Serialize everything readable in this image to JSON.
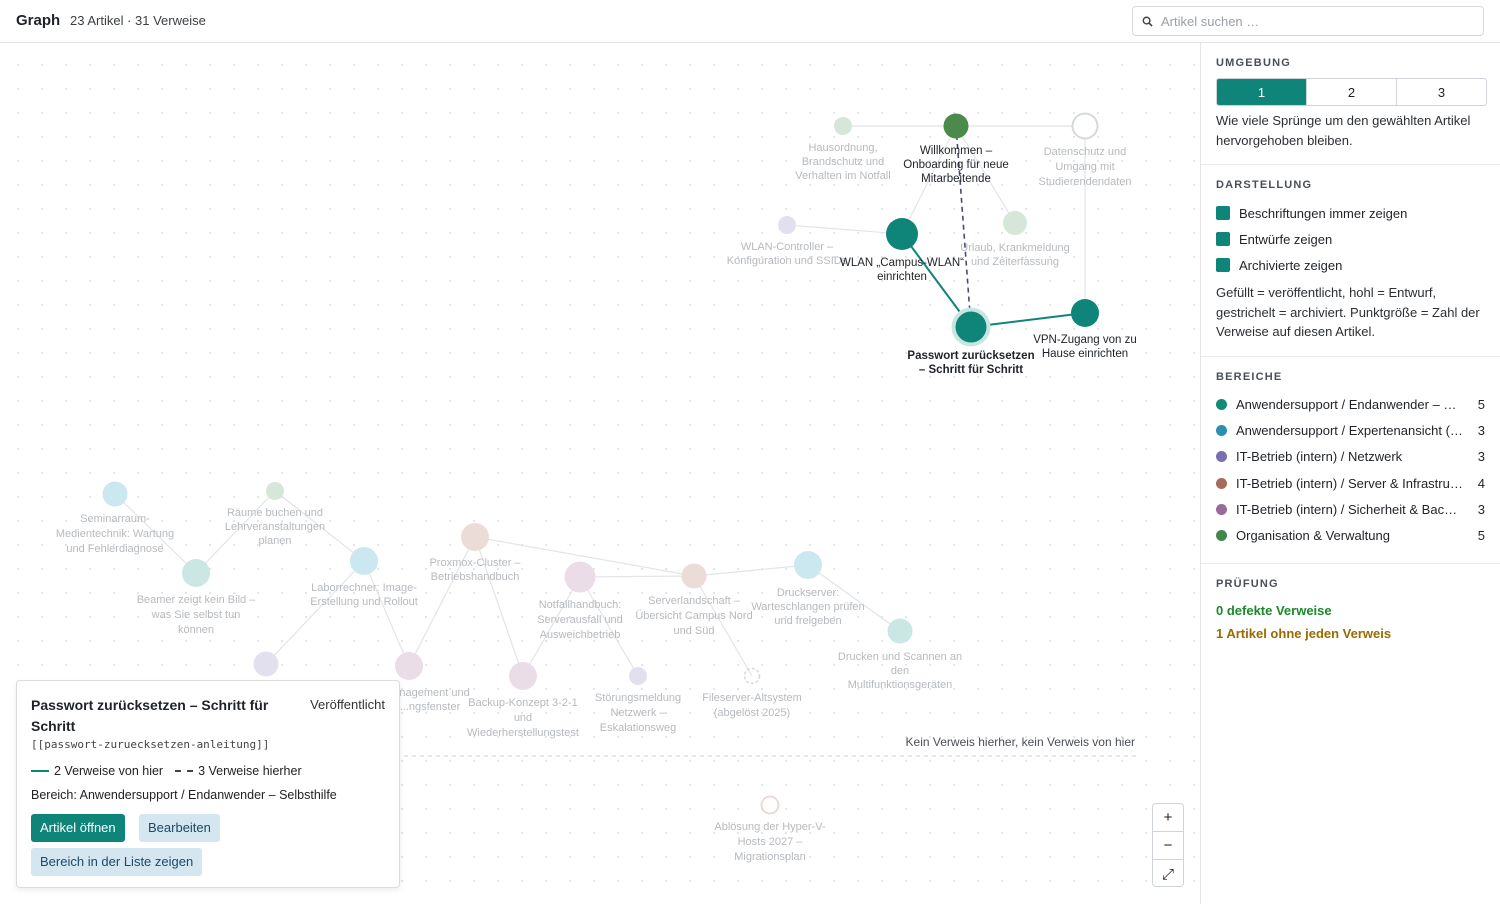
{
  "header": {
    "title": "Graph",
    "counts": "23 Artikel · 31 Verweise",
    "search_placeholder": "Artikel suchen …"
  },
  "sidebar": {
    "umgebung": {
      "heading": "UMGEBUNG",
      "options": [
        "1",
        "2",
        "3"
      ],
      "selected": "1",
      "note": "Wie viele Sprünge um den gewählten Artikel hervorgehoben bleiben."
    },
    "darstellung": {
      "heading": "DARSTELLUNG",
      "checks": [
        {
          "label": "Beschriftungen immer zeigen",
          "checked": true
        },
        {
          "label": "Entwürfe zeigen",
          "checked": true
        },
        {
          "label": "Archivierte zeigen",
          "checked": true
        }
      ],
      "note": "Gefüllt = veröffentlicht, hohl = Entwurf, gestrichelt = archiviert. Punktgröße = Zahl der Verweise auf diesen Artikel."
    },
    "bereiche": {
      "heading": "BEREICHE",
      "items": [
        {
          "label": "Anwendersupport / Endanwender – Selbsthilfe",
          "count": "5",
          "color": "#138a78"
        },
        {
          "label": "Anwendersupport / Expertenansicht (Service Desk)",
          "count": "3",
          "color": "#2a8fb0"
        },
        {
          "label": "IT-Betrieb (intern) / Netzwerk",
          "count": "3",
          "color": "#7b6fb2"
        },
        {
          "label": "IT-Betrieb (intern) / Server & Infrastruktur",
          "count": "4",
          "color": "#a86a5a"
        },
        {
          "label": "IT-Betrieb (intern) / Sicherheit & Backup",
          "count": "3",
          "color": "#9a6a98"
        },
        {
          "label": "Organisation & Verwaltung",
          "count": "5",
          "color": "#3f8a4a"
        }
      ]
    },
    "pruefung": {
      "heading": "PRÜFUNG",
      "ok": "0 defekte Verweise",
      "warn": "1 Artikel ohne jeden Verweis"
    }
  },
  "graph": {
    "labels": {
      "passwort": [
        "Passwort zurücksetzen",
        "– Schritt für Schritt"
      ],
      "willkommen": [
        "Willkommen –",
        "Onboarding für neue",
        "Mitarbeitende"
      ],
      "hausordnung": [
        "Hausordnung,",
        "Brandschutz und",
        "Verhalten im Notfall"
      ],
      "datenschutz": [
        "Datenschutz und",
        "Umgang mit",
        "Studierendendaten"
      ],
      "wlan_controller": [
        "WLAN-Controller –",
        "Konfiguration und SSIDs"
      ],
      "wlan": [
        "WLAN „Campus-WLAN“",
        "einrichten"
      ],
      "urlaub": [
        "Urlaub, Krankmeldung",
        "und Zeiterfassung"
      ],
      "vpn": [
        "VPN-Zugang von zu",
        "Hause einrichten"
      ],
      "seminar": [
        "Seminarraum-",
        "Medientechnik: Wartung",
        "und Fehlerdiagnose"
      ],
      "raeume": [
        "Räume buchen und",
        "Lehrveranstaltungen",
        "planen"
      ],
      "beamer": [
        "Beamer zeigt kein Bild –",
        "was Sie selbst tun",
        "können"
      ],
      "labor": [
        "Laborrechner: Image-",
        "Erstellung und Rollout"
      ],
      "proxmox": [
        "Proxmox-Cluster –",
        "Betriebshandbuch"
      ],
      "notfall": [
        "Notfallhandbuch:",
        "Serverausfall und",
        "Ausweichbetrieb"
      ],
      "serverlandschaft": [
        "Serverlandschaft –",
        "Übersicht Campus Nord",
        "und Süd"
      ],
      "drucker": [
        "Druckserver:",
        "Warteschlangen prüfen",
        "und freigeben"
      ],
      "drucken": [
        "Drucken und Scannen an",
        "den",
        "Multifunktionsgeräten"
      ],
      "management": [
        "...nagement und",
        "...ngsfenster"
      ],
      "backup": [
        "Backup-Konzept 3-2-1",
        "und",
        "Wiederherstellungstest"
      ],
      "stoerung": [
        "Störungsmeldung",
        "Netzwerk –",
        "Eskalationsweg"
      ],
      "fileserver": [
        "Fileserver-Altsystem",
        "(abgelöst 2025)"
      ],
      "hyperv": [
        "Ablösung der Hyper-V-",
        "Hosts 2027 –",
        "Migrationsplan"
      ]
    },
    "orphan_caption": "Kein Verweis hierher, kein Verweis von hier"
  },
  "card": {
    "title": "Passwort zurücksetzen – Schritt für Schritt",
    "status": "Veröffentlicht",
    "slug": "[[passwort-zuruecksetzen-anleitung]]",
    "links_from": "2 Verweise von hier",
    "links_to": "3 Verweise hierher",
    "bereich": "Bereich: Anwendersupport / Endanwender – Selbsthilfe",
    "open_label": "Artikel öffnen",
    "edit_label": "Bearbeiten",
    "list_label": "Bereich in der Liste zeigen"
  },
  "zoom": {
    "in": "+",
    "out": "−",
    "fit": "⤢"
  }
}
